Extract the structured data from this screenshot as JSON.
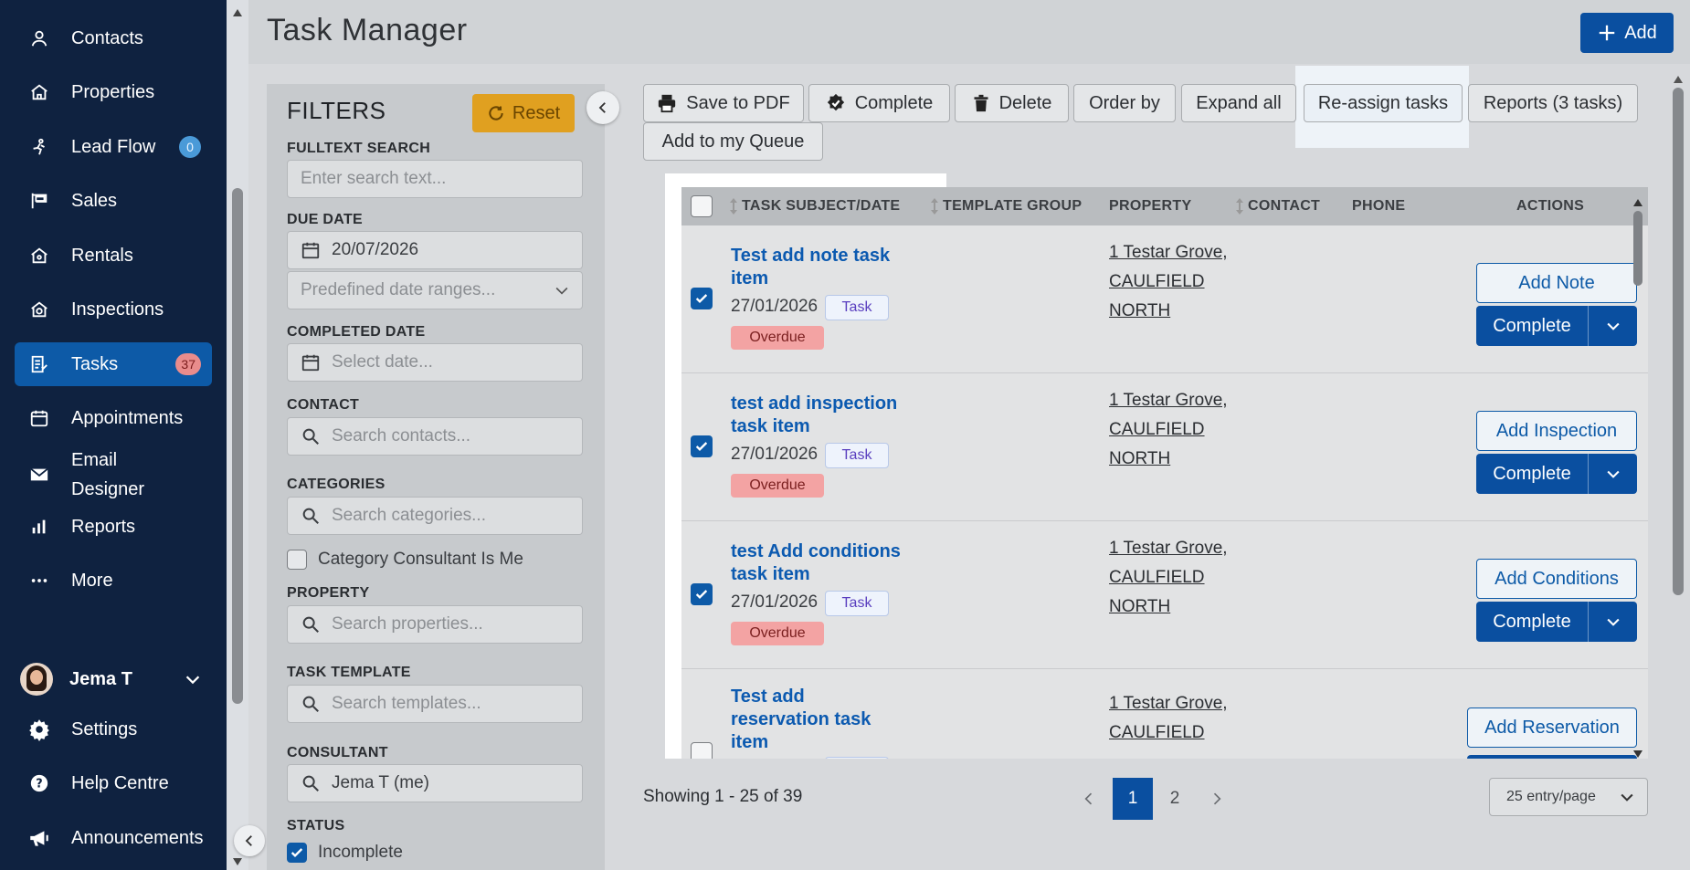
{
  "sidebar": {
    "items": [
      {
        "label": "Contacts",
        "icon": "person-icon"
      },
      {
        "label": "Properties",
        "icon": "house-icon"
      },
      {
        "label": "Lead Flow",
        "icon": "lead-flow-icon",
        "badge": "0"
      },
      {
        "label": "Sales",
        "icon": "sign-icon"
      },
      {
        "label": "Rentals",
        "icon": "rental-house-icon"
      },
      {
        "label": "Inspections",
        "icon": "inspection-house-icon"
      },
      {
        "label": "Tasks",
        "icon": "tasks-icon",
        "badge": "37"
      },
      {
        "label": "Appointments",
        "icon": "calendar-icon"
      },
      {
        "label": "Email Designer",
        "icon": "envelope-icon"
      },
      {
        "label": "Reports",
        "icon": "bar-chart-icon"
      },
      {
        "label": "More",
        "icon": "ellipsis-icon"
      }
    ],
    "user": "Jema T",
    "footer": [
      {
        "label": "Settings",
        "icon": "gear-icon"
      },
      {
        "label": "Help Centre",
        "icon": "help-icon"
      },
      {
        "label": "Announcements",
        "icon": "megaphone-icon"
      }
    ]
  },
  "header": {
    "title": "Task Manager",
    "add_label": "Add"
  },
  "filters": {
    "title": "FILTERS",
    "reset_label": "Reset",
    "fulltext_label": "FULLTEXT SEARCH",
    "fulltext_placeholder": "Enter search text...",
    "due_date_label": "DUE DATE",
    "due_date_value": "20/07/2026",
    "date_ranges_placeholder": "Predefined date ranges...",
    "completed_date_label": "COMPLETED DATE",
    "completed_date_placeholder": "Select date...",
    "contact_label": "CONTACT",
    "contact_placeholder": "Search contacts...",
    "categories_label": "CATEGORIES",
    "categories_placeholder": "Search categories...",
    "category_consultant_label": "Category Consultant Is Me",
    "property_label": "PROPERTY",
    "property_placeholder": "Search properties...",
    "task_template_label": "TASK TEMPLATE",
    "task_template_placeholder": "Search templates...",
    "consultant_label": "CONSULTANT",
    "consultant_value": "Jema T (me)",
    "status_label": "STATUS",
    "status_option": "Incomplete"
  },
  "toolbar": {
    "save_pdf": "Save to PDF",
    "complete": "Complete",
    "delete": "Delete",
    "order_by": "Order by",
    "expand_all": "Expand all",
    "reassign": "Re-assign tasks",
    "reports": "Reports (3 tasks)",
    "add_queue": "Add to my Queue"
  },
  "table": {
    "columns": [
      "TASK SUBJECT/DATE",
      "TEMPLATE GROUP",
      "PROPERTY",
      "CONTACT",
      "PHONE",
      "ACTIONS"
    ],
    "rows": [
      {
        "title": "Test add note task item",
        "date": "27/01/2026",
        "type": "Task",
        "status": "Overdue",
        "property": "1 Testar Grove, CAULFIELD NORTH",
        "action": "Add Note",
        "complete": "Complete",
        "checked": true
      },
      {
        "title": "test add inspection task item",
        "date": "27/01/2026",
        "type": "Task",
        "status": "Overdue",
        "property": "1 Testar Grove, CAULFIELD NORTH",
        "action": "Add Inspection",
        "complete": "Complete",
        "checked": true
      },
      {
        "title": "test Add conditions task item",
        "date": "27/01/2026",
        "type": "Task",
        "status": "Overdue",
        "property": "1 Testar Grove, CAULFIELD NORTH",
        "action": "Add Conditions",
        "complete": "Complete",
        "checked": true
      },
      {
        "title": "Test add reservation task item",
        "date": "",
        "type": "",
        "status": "",
        "property": "1 Testar Grove, CAULFIELD",
        "action": "Add Reservation",
        "complete": "",
        "checked": false
      }
    ]
  },
  "pagination": {
    "showing": "Showing 1 - 25 of 39",
    "pages": [
      "1",
      "2"
    ],
    "current": "1",
    "per_page": "25 entry/page"
  }
}
